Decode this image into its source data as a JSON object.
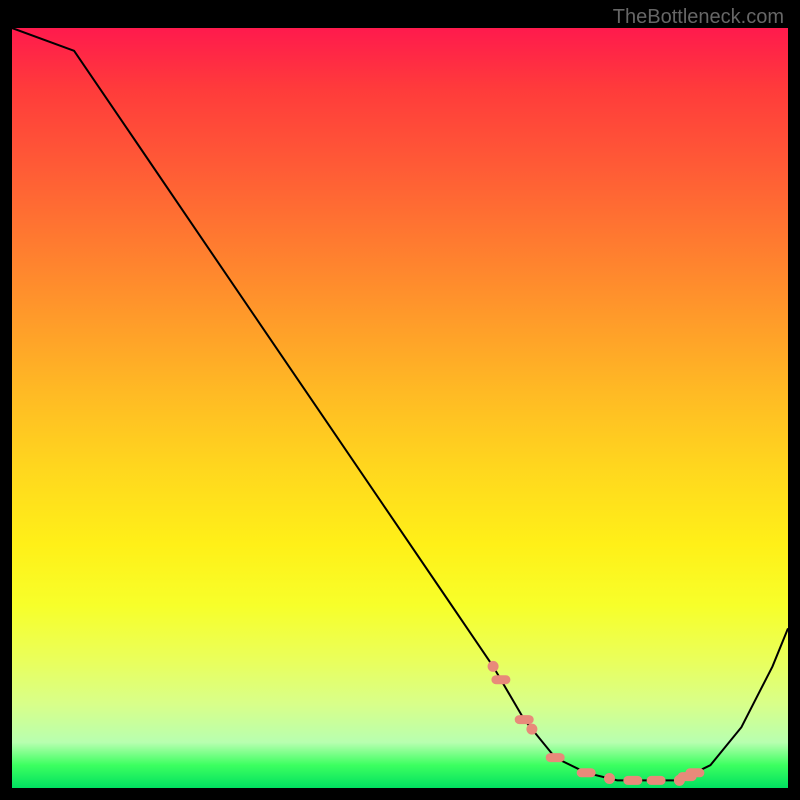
{
  "watermark": "TheBottleneck.com",
  "chart_data": {
    "type": "line",
    "title": "",
    "xlabel": "",
    "ylabel": "",
    "xlim": [
      0,
      100
    ],
    "ylim": [
      0,
      100
    ],
    "note": "Bottleneck-style curve on red→green vertical gradient. Y axis: higher = worse (red), lower = better (green). Curve descends from top-left, reaches a flat minimum around x≈70–86, rises toward the right edge.",
    "series": [
      {
        "name": "curve",
        "x": [
          0,
          8,
          16,
          24,
          32,
          40,
          48,
          56,
          62,
          66,
          70,
          74,
          78,
          82,
          86,
          90,
          94,
          98,
          100
        ],
        "values": [
          100,
          97,
          85,
          73,
          61,
          49,
          37,
          25,
          16,
          9,
          4,
          2,
          1,
          1,
          1,
          3,
          8,
          16,
          21
        ]
      }
    ],
    "markers": {
      "note": "Salmon rounded markers clustered along the trough of the curve",
      "color": "#e88a7a",
      "points_x": [
        62,
        63,
        66,
        67,
        70,
        74,
        77,
        80,
        83,
        86,
        87,
        88
      ],
      "style": "mix of small dots and short horizontal capsules lying on the curve"
    },
    "background_gradient": {
      "direction": "top-to-bottom",
      "stops": [
        {
          "pos": 0.0,
          "color": "#ff1a4d"
        },
        {
          "pos": 0.5,
          "color": "#ffd71e"
        },
        {
          "pos": 0.95,
          "color": "#b8ffb0"
        },
        {
          "pos": 1.0,
          "color": "#00e060"
        }
      ]
    }
  }
}
